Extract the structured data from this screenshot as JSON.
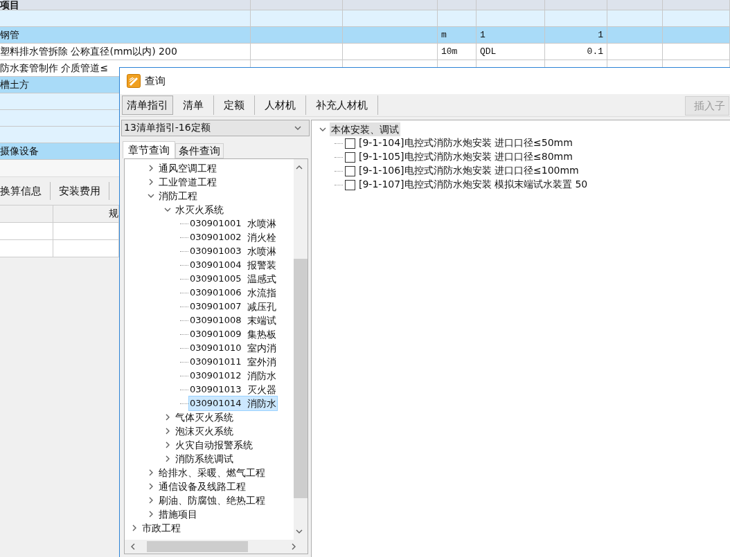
{
  "background_grid": {
    "header": "项目",
    "rows": [
      {
        "kind": "empty"
      },
      {
        "kind": "category",
        "name": "钢管",
        "unit": "m",
        "column_3": "1",
        "quantity": "1"
      },
      {
        "kind": "detail",
        "name": "塑料排水管拆除 公称直径(mm以内) 200",
        "unit": "10m",
        "column_3": "QDL",
        "quantity": "0.1"
      },
      {
        "kind": "detail",
        "name": "防水套管制作 介质管道≤"
      },
      {
        "kind": "category",
        "name": "槽土方"
      },
      {
        "kind": "empty"
      },
      {
        "kind": "empty"
      },
      {
        "kind": "empty"
      },
      {
        "kind": "category",
        "name": "摄像设备"
      }
    ]
  },
  "detail_tabs": [
    "换算信息",
    "安装费用"
  ],
  "detail_grid": {
    "column_2": "规"
  },
  "dialog": {
    "title": "查询",
    "tabs": [
      {
        "label": "清单指引",
        "selected": true
      },
      {
        "label": "清单",
        "selected": false
      },
      {
        "label": "定额",
        "selected": false
      },
      {
        "label": "人材机",
        "selected": false
      },
      {
        "label": "补充人材机",
        "selected": false
      }
    ],
    "insert_button": {
      "label": "插入子",
      "disabled": true
    },
    "library_select": {
      "value": "13清单指引-16定额"
    },
    "subtabs": [
      {
        "label": "章节查询",
        "selected": true
      },
      {
        "label": "条件查询",
        "selected": false
      }
    ],
    "chapter_tree": [
      {
        "children": [
          {
            "label": "通风空调工程",
            "expanded": false,
            "selected": false
          },
          {
            "label": "工业管道工程",
            "expanded": false,
            "selected": false
          },
          {
            "label": "消防工程",
            "expanded": true,
            "selected": false,
            "children": [
              {
                "label": "水灭火系统",
                "expanded": true,
                "selected": false,
                "children": [
                  {
                    "code": "030901001",
                    "name": "水喷淋",
                    "selected": false
                  },
                  {
                    "code": "030901002",
                    "name": "消火栓",
                    "selected": false
                  },
                  {
                    "code": "030901003",
                    "name": "水喷淋",
                    "selected": false
                  },
                  {
                    "code": "030901004",
                    "name": "报警装",
                    "selected": false
                  },
                  {
                    "code": "030901005",
                    "name": "温感式",
                    "selected": false
                  },
                  {
                    "code": "030901006",
                    "name": "水流指",
                    "selected": false
                  },
                  {
                    "code": "030901007",
                    "name": "减压孔",
                    "selected": false
                  },
                  {
                    "code": "030901008",
                    "name": "末端试",
                    "selected": false
                  },
                  {
                    "code": "030901009",
                    "name": "集热板",
                    "selected": false
                  },
                  {
                    "code": "030901010",
                    "name": "室内消",
                    "selected": false
                  },
                  {
                    "code": "030901011",
                    "name": "室外消",
                    "selected": false
                  },
                  {
                    "code": "030901012",
                    "name": "消防水",
                    "selected": false
                  },
                  {
                    "code": "030901013",
                    "name": "灭火器",
                    "selected": false
                  },
                  {
                    "code": "030901014",
                    "name": "消防水",
                    "selected": true
                  }
                ]
              },
              {
                "label": "气体灭火系统",
                "expanded": false,
                "selected": false
              },
              {
                "label": "泡沫灭火系统",
                "expanded": false,
                "selected": false
              },
              {
                "label": "火灾自动报警系统",
                "expanded": false,
                "selected": false
              },
              {
                "label": "消防系统调试",
                "expanded": false,
                "selected": false
              }
            ]
          },
          {
            "label": "给排水、采暖、燃气工程",
            "expanded": false,
            "selected": false
          },
          {
            "label": "通信设备及线路工程",
            "expanded": false,
            "selected": false
          },
          {
            "label": "刷油、防腐蚀、绝热工程",
            "expanded": false,
            "selected": false
          },
          {
            "label": "措施项目",
            "expanded": false,
            "selected": false
          }
        ]
      },
      {
        "label": "市政工程",
        "expanded": false,
        "selected": false
      }
    ],
    "quota_tree": [
      {
        "label": "本体安装、调试",
        "expanded": true,
        "selected": true,
        "children": [
          {
            "label": "[9-1-104]电控式消防水炮安装 进口口径≤50mm",
            "checked": false
          },
          {
            "label": "[9-1-105]电控式消防水炮安装 进口口径≤80mm",
            "checked": false
          },
          {
            "label": "[9-1-106]电控式消防水炮安装 进口口径≤100mm",
            "checked": false
          },
          {
            "label": "[9-1-107]电控式消防水炮安装 模拟末端试水装置 50",
            "checked": false
          }
        ]
      }
    ]
  }
}
